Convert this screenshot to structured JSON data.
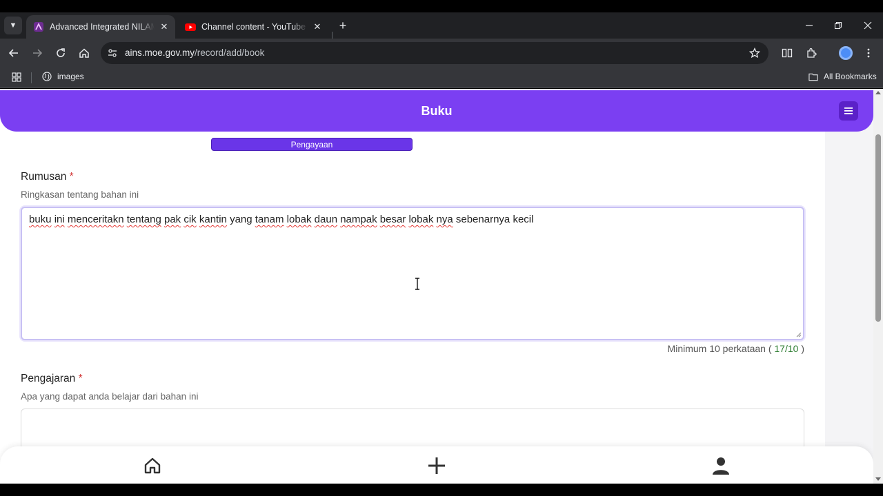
{
  "browser": {
    "tabs": [
      {
        "title": "Advanced Integrated NILAM Sy",
        "active": true
      },
      {
        "title": "Channel content - YouTube Stu",
        "active": false
      }
    ],
    "url_domain": "ains.moe.gov.my",
    "url_path": "/record/add/book",
    "bookmarks": [
      {
        "label": "images"
      }
    ],
    "all_bookmarks_label": "All Bookmarks"
  },
  "app": {
    "title": "Buku",
    "accent_color": "#7b3ff2"
  },
  "form": {
    "category_chip": "Pengayaan",
    "rumusan": {
      "label": "Rumusan",
      "required_mark": "*",
      "help": "Ringkasan tentang bahan ini",
      "words": [
        {
          "w": "buku",
          "err": true
        },
        {
          "w": "ini",
          "err": true
        },
        {
          "w": "menceritakn",
          "err": true
        },
        {
          "w": "tentang",
          "err": true
        },
        {
          "w": "pak",
          "err": true
        },
        {
          "w": "cik",
          "err": true
        },
        {
          "w": "kantin",
          "err": true
        },
        {
          "w": "yang",
          "err": false
        },
        {
          "w": "tanam",
          "err": true
        },
        {
          "w": "lobak",
          "err": true
        },
        {
          "w": "daun",
          "err": true
        },
        {
          "w": "nampak",
          "err": true
        },
        {
          "w": "besar",
          "err": true
        },
        {
          "w": "lobak",
          "err": true
        },
        {
          "w": "nya",
          "err": true
        },
        {
          "w": "sebenarnya",
          "err": false
        },
        {
          "w": "kecil",
          "err": false
        }
      ],
      "counter_prefix": "Minimum 10 perkataan ( ",
      "counter_value": "17/10",
      "counter_suffix": " )"
    },
    "pengajaran": {
      "label": "Pengajaran",
      "required_mark": "*",
      "help": "Apa yang dapat anda belajar dari bahan ini"
    }
  },
  "bottom_nav": [
    {
      "icon": "home-icon"
    },
    {
      "icon": "plus-icon"
    },
    {
      "icon": "user-icon"
    }
  ]
}
